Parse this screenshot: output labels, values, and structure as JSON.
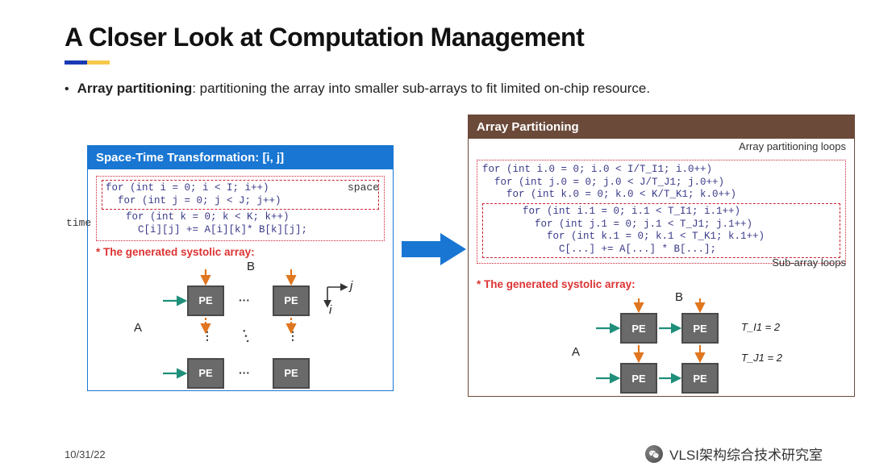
{
  "title": "A Closer Look at Computation Management",
  "bullet": {
    "term": "Array partitioning",
    "rest": ": partitioning the array into smaller sub-arrays to fit limited on-chip resource."
  },
  "left": {
    "header": "Space-Time Transformation: [i, j]",
    "annot_space": "space",
    "annot_time": "time",
    "code": {
      "l1": "for (int i = 0; i < I; i++)",
      "l2": "  for (int j = 0; j < J; j++)",
      "l3": "    for (int k = 0; k < K; k++)",
      "l4": "      C[i][j] += A[i][k]* B[k][j];"
    },
    "gen": "* The generated systolic array:",
    "A": "A",
    "B": "B",
    "PE": "PE",
    "i": "i",
    "j": "j",
    "dots_h": "···",
    "dots_v": "⋮",
    "dots_d": "⋱"
  },
  "right": {
    "header": "Array Partitioning",
    "loops_label": "Array partitioning loops",
    "subarr_label": "Sub-array loops",
    "code": {
      "l1": "for (int i.0 = 0; i.0 < I/T_I1; i.0++)",
      "l2": "  for (int j.0 = 0; j.0 < J/T_J1; j.0++)",
      "l3": "    for (int k.0 = 0; k.0 < K/T_K1; k.0++)",
      "l4": "      for (int i.1 = 0; i.1 < T_I1; i.1++)",
      "l5": "        for (int j.1 = 0; j.1 < T_J1; j.1++)",
      "l6": "          for (int k.1 = 0; k.1 < T_K1; k.1++)",
      "l7": "            C[...] += A[...] * B[...];"
    },
    "gen": "* The generated systolic array:",
    "A": "A",
    "B": "B",
    "PE": "PE",
    "ti": "T_I1 = 2",
    "tj": "T_J1 = 2"
  },
  "footer": {
    "date": "10/31/22",
    "brand": "VLSI架构综合技术研究室"
  },
  "colors": {
    "arrow_orange": "#e0761f",
    "arrow_teal": "#1f8f7a",
    "big_arrow": "#1976d2"
  }
}
